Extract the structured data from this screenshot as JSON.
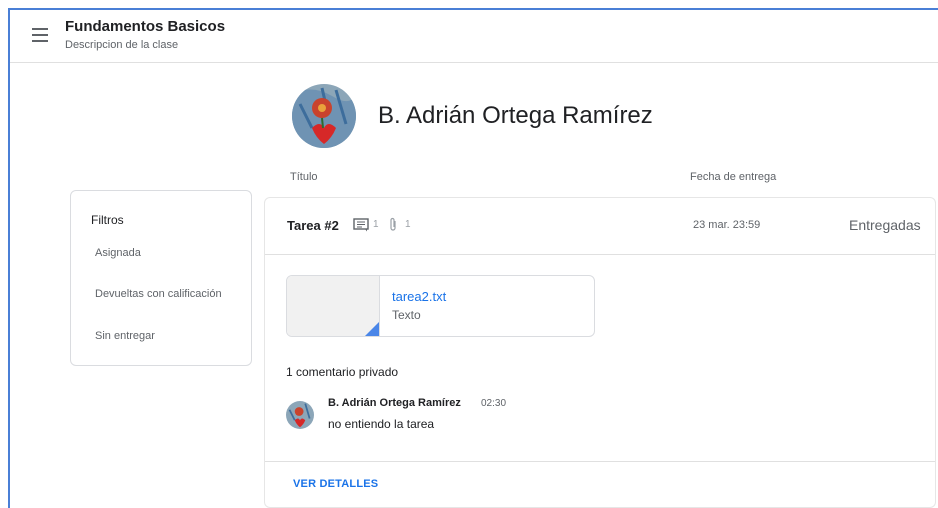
{
  "header": {
    "title": "Fundamentos Basicos",
    "subtitle": "Descripcion de la clase",
    "menu_icon": "hamburger-menu-icon"
  },
  "student": {
    "name": "B. Adrián Ortega Ramírez",
    "avatar_icon": "student-avatar"
  },
  "columns": {
    "title": "Título",
    "due": "Fecha de entrega"
  },
  "filters": {
    "title": "Filtros",
    "items": [
      "Asignada",
      "Devueltas con calificación",
      "Sin entregar"
    ]
  },
  "assignment": {
    "title": "Tarea #2",
    "comments_count": "1",
    "attachments_count": "1",
    "due": "23 mar. 23:59",
    "status": "Entregadas",
    "attachment": {
      "name": "tarea2.txt",
      "type": "Texto"
    },
    "private_comments_label": "1 comentario privado",
    "comment": {
      "author": "B. Adrián Ortega Ramírez",
      "time": "02:30",
      "text": "no entiendo la tarea"
    },
    "details_label": "VER DETALLES"
  },
  "colors": {
    "accent": "#1a73e8",
    "frame": "#4a7fd6"
  }
}
